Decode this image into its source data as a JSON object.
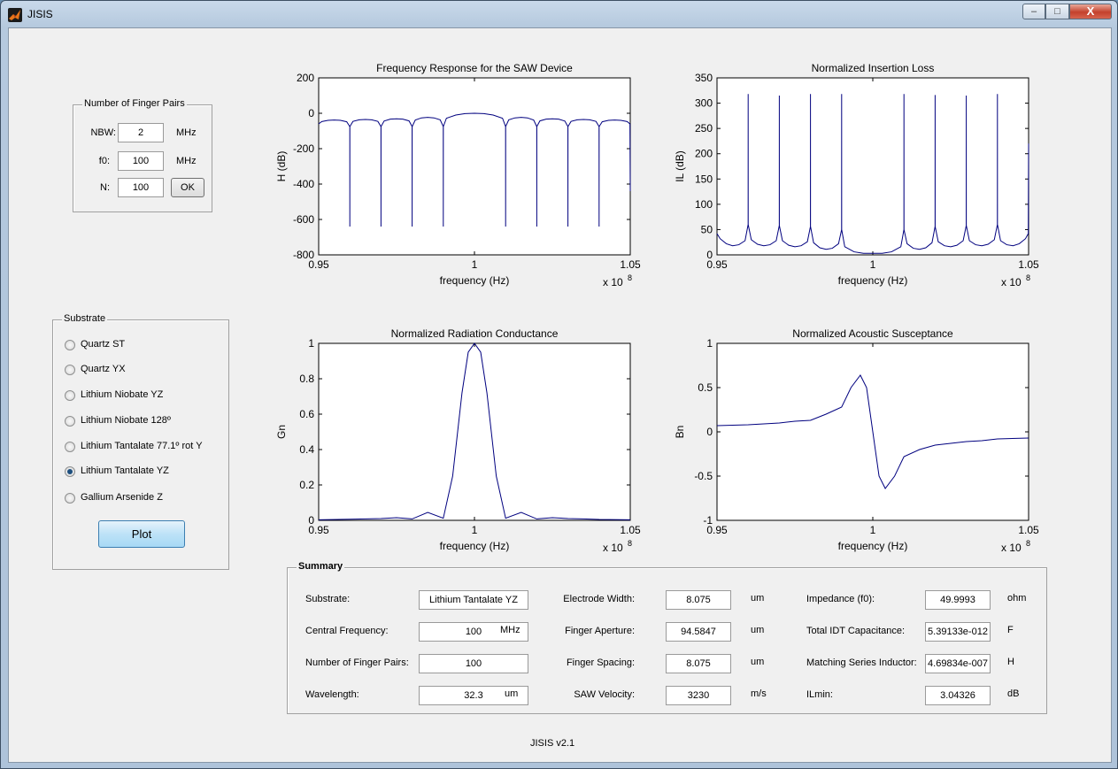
{
  "window": {
    "title": "JISIS",
    "controls": {
      "minimize": "–",
      "maximize": "□",
      "close": "X"
    }
  },
  "finger_pairs": {
    "title": "Number of Finger Pairs",
    "fields": [
      {
        "label": "NBW:",
        "value": "2",
        "unit": "MHz"
      },
      {
        "label": "f0:",
        "value": "100",
        "unit": "MHz"
      },
      {
        "label": "N:",
        "value": "100"
      }
    ],
    "ok_label": "OK"
  },
  "substrate": {
    "title": "Substrate",
    "options": [
      {
        "label": "Quartz ST",
        "checked": false
      },
      {
        "label": "Quartz YX",
        "checked": false
      },
      {
        "label": "Lithium Niobate YZ",
        "checked": false
      },
      {
        "label": "Lithium Niobate 128º",
        "checked": false
      },
      {
        "label": "Lithium Tantalate 77.1º rot Y",
        "checked": false
      },
      {
        "label": "Lithium Tantalate YZ",
        "checked": true
      },
      {
        "label": "Gallium Arsenide Z",
        "checked": false
      }
    ],
    "plot_label": "Plot"
  },
  "chart_data": [
    {
      "type": "line",
      "title": "Frequency Response for the SAW Device",
      "xlabel": "frequency (Hz)",
      "ylabel": "H (dB)",
      "x_multiplier": "x 10",
      "x_exponent": "8",
      "xlim": [
        0.95,
        1.05
      ],
      "ylim": [
        -800,
        200
      ],
      "xticks": [
        "0.95",
        "1",
        "1.05"
      ],
      "yticks": [
        "200",
        "0",
        "-200",
        "-400",
        "-600",
        "-800"
      ],
      "color": "#00007f",
      "series": [
        {
          "x": [
            0.95,
            0.951,
            0.953,
            0.955,
            0.957,
            0.959,
            0.95999,
            0.96,
            0.96001,
            0.961,
            0.963,
            0.965,
            0.967,
            0.969,
            0.96999,
            0.97,
            0.97001,
            0.971,
            0.973,
            0.975,
            0.977,
            0.979,
            0.97999,
            0.98,
            0.98001,
            0.981,
            0.983,
            0.985,
            0.987,
            0.989,
            0.98999,
            0.99,
            0.99001,
            0.991,
            0.994,
            0.997,
            1.0,
            1.003,
            1.006,
            1.009,
            1.00999,
            1.01,
            1.01001,
            1.011,
            1.013,
            1.015,
            1.017,
            1.019,
            1.01999,
            1.02,
            1.02001,
            1.021,
            1.023,
            1.025,
            1.027,
            1.029,
            1.02999,
            1.03,
            1.03001,
            1.031,
            1.033,
            1.035,
            1.037,
            1.039,
            1.03999,
            1.04,
            1.04001,
            1.041,
            1.043,
            1.045,
            1.047,
            1.049,
            1.0499,
            1.05
          ],
          "y": [
            -60,
            -47,
            -40,
            -38,
            -40,
            -48,
            -75,
            -640,
            -75,
            -46,
            -37,
            -35,
            -37,
            -46,
            -75,
            -640,
            -75,
            -44,
            -33,
            -31,
            -33,
            -43,
            -75,
            -640,
            -75,
            -38,
            -26,
            -23,
            -26,
            -37,
            -75,
            -640,
            -75,
            -28,
            -10,
            -2,
            0,
            -2,
            -10,
            -28,
            -75,
            -640,
            -75,
            -37,
            -26,
            -23,
            -26,
            -38,
            -75,
            -640,
            -75,
            -43,
            -33,
            -31,
            -33,
            -44,
            -75,
            -640,
            -75,
            -46,
            -37,
            -35,
            -37,
            -46,
            -75,
            -640,
            -75,
            -48,
            -40,
            -38,
            -40,
            -47,
            -60,
            -440
          ]
        }
      ]
    },
    {
      "type": "line",
      "title": "Normalized Insertion Loss",
      "xlabel": "frequency (Hz)",
      "ylabel": "IL (dB)",
      "x_multiplier": "x 10",
      "x_exponent": "8",
      "xlim": [
        0.95,
        1.05
      ],
      "ylim": [
        0,
        350
      ],
      "xticks": [
        "0.95",
        "1",
        "1.05"
      ],
      "yticks": [
        "350",
        "300",
        "250",
        "200",
        "150",
        "100",
        "50",
        "0"
      ],
      "color": "#00007f",
      "series": [
        {
          "x": [
            0.95,
            0.951,
            0.953,
            0.955,
            0.957,
            0.959,
            0.95999,
            0.96,
            0.96001,
            0.961,
            0.963,
            0.965,
            0.967,
            0.969,
            0.96999,
            0.97,
            0.97001,
            0.971,
            0.973,
            0.975,
            0.977,
            0.979,
            0.97999,
            0.98,
            0.98001,
            0.981,
            0.983,
            0.985,
            0.987,
            0.989,
            0.98999,
            0.99,
            0.99001,
            0.991,
            0.994,
            0.997,
            1.0,
            1.003,
            1.006,
            1.009,
            1.00999,
            1.01,
            1.01001,
            1.011,
            1.013,
            1.015,
            1.017,
            1.019,
            1.01999,
            1.02,
            1.02001,
            1.021,
            1.023,
            1.025,
            1.027,
            1.029,
            1.02999,
            1.03,
            1.03001,
            1.031,
            1.033,
            1.035,
            1.037,
            1.039,
            1.03999,
            1.04,
            1.04001,
            1.041,
            1.043,
            1.045,
            1.047,
            1.049,
            1.0499,
            1.05
          ],
          "y": [
            42,
            32,
            22,
            18,
            20,
            28,
            60,
            318,
            60,
            30,
            21,
            18,
            20,
            28,
            58,
            315,
            58,
            28,
            19,
            16,
            18,
            26,
            56,
            318,
            56,
            24,
            14,
            11,
            13,
            22,
            50,
            318,
            50,
            16,
            6,
            3,
            3,
            3,
            6,
            16,
            50,
            318,
            50,
            22,
            13,
            11,
            14,
            24,
            56,
            316,
            56,
            26,
            18,
            16,
            19,
            28,
            58,
            315,
            58,
            28,
            20,
            18,
            21,
            30,
            60,
            318,
            60,
            28,
            20,
            18,
            22,
            32,
            42,
            220
          ]
        }
      ]
    },
    {
      "type": "line",
      "title": "Normalized Radiation Conductance",
      "xlabel": "frequency (Hz)",
      "ylabel": "Gn",
      "x_multiplier": "x 10",
      "x_exponent": "8",
      "xlim": [
        0.95,
        1.05
      ],
      "ylim": [
        0,
        1
      ],
      "xticks": [
        "0.95",
        "1",
        "1.05"
      ],
      "yticks": [
        "1",
        "0.8",
        "0.6",
        "0.4",
        "0.2",
        "0"
      ],
      "color": "#00007f",
      "series": [
        {
          "x": [
            0.95,
            0.96,
            0.965,
            0.97,
            0.975,
            0.98,
            0.985,
            0.99,
            0.993,
            0.996,
            0.998,
            1.0,
            1.002,
            1.004,
            1.007,
            1.01,
            1.015,
            1.02,
            1.025,
            1.03,
            1.035,
            1.04,
            1.05
          ],
          "y": [
            0.003,
            0.006,
            0.008,
            0.01,
            0.015,
            0.008,
            0.045,
            0.012,
            0.25,
            0.72,
            0.95,
            1.0,
            0.95,
            0.72,
            0.25,
            0.012,
            0.045,
            0.008,
            0.015,
            0.01,
            0.008,
            0.005,
            0.003
          ]
        }
      ]
    },
    {
      "type": "line",
      "title": "Normalized Acoustic Susceptance",
      "xlabel": "frequency (Hz)",
      "ylabel": "Bn",
      "x_multiplier": "x 10",
      "x_exponent": "8",
      "xlim": [
        0.95,
        1.05
      ],
      "ylim": [
        -1,
        1
      ],
      "xticks": [
        "0.95",
        "1",
        "1.05"
      ],
      "yticks": [
        "1",
        "0.5",
        "0",
        "-0.5",
        "-1"
      ],
      "color": "#00007f",
      "series": [
        {
          "x": [
            0.95,
            0.96,
            0.965,
            0.97,
            0.975,
            0.98,
            0.985,
            0.99,
            0.993,
            0.996,
            0.998,
            1.0,
            1.002,
            1.004,
            1.007,
            1.01,
            1.015,
            1.02,
            1.025,
            1.03,
            1.035,
            1.04,
            1.05
          ],
          "y": [
            0.07,
            0.08,
            0.09,
            0.1,
            0.12,
            0.13,
            0.2,
            0.28,
            0.5,
            0.64,
            0.5,
            0.0,
            -0.5,
            -0.64,
            -0.5,
            -0.28,
            -0.2,
            -0.15,
            -0.13,
            -0.11,
            -0.1,
            -0.08,
            -0.07
          ]
        }
      ]
    }
  ],
  "summary": {
    "title": "Summary",
    "items": [
      {
        "label": "Substrate:",
        "value": "Lithium Tantalate YZ",
        "unit": ""
      },
      {
        "label": "Central Frequency:",
        "value": "100",
        "unit": "MHz"
      },
      {
        "label": "Number of Finger Pairs:",
        "value": "100",
        "unit": ""
      },
      {
        "label": "Wavelength:",
        "value": "32.3",
        "unit": "um"
      },
      {
        "label": "Electrode Width:",
        "value": "8.075",
        "unit": "um"
      },
      {
        "label": "Finger Aperture:",
        "value": "94.5847",
        "unit": "um"
      },
      {
        "label": "Finger Spacing:",
        "value": "8.075",
        "unit": "um"
      },
      {
        "label": "SAW Velocity:",
        "value": "3230",
        "unit": "m/s"
      },
      {
        "label": "Impedance (f0):",
        "value": "49.9993",
        "unit": "ohm"
      },
      {
        "label": "Total IDT Capacitance:",
        "value": "5.39133e-012",
        "unit": "F"
      },
      {
        "label": "Matching Series Inductor:",
        "value": "4.69834e-007",
        "unit": "H"
      },
      {
        "label": "ILmin:",
        "value": "3.04326",
        "unit": "dB"
      }
    ]
  },
  "footer": "JISIS v2.1"
}
